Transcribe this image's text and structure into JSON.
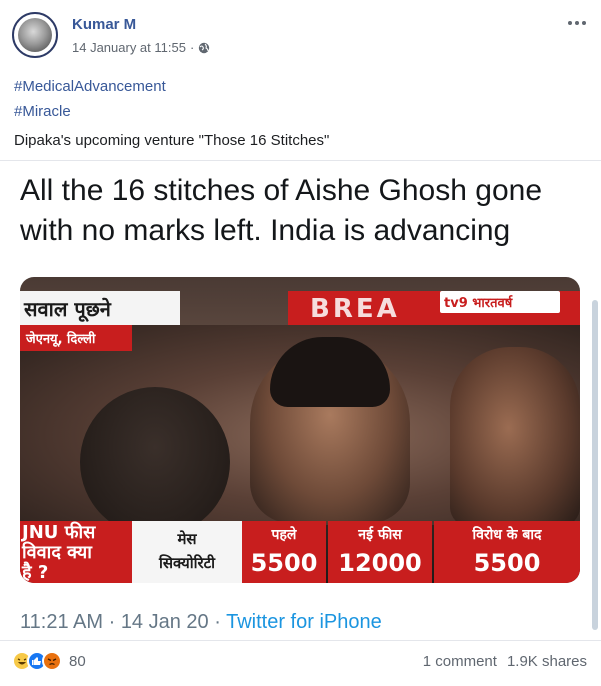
{
  "post": {
    "author": "Kumar M",
    "timestamp": "14 January at 11:55",
    "privacy_icon": "globe-icon",
    "hashtags": [
      "#MedicalAdvancement",
      "#Miracle"
    ],
    "caption": "Dipaka's upcoming venture \"Those 16 Stitches\""
  },
  "tweet": {
    "text": "All the 16 stitches of Aishe Ghosh gone with no marks left. India is advancing",
    "media": {
      "top_left": "सवाल पूछने",
      "sub": "जेएनयू, दिल्ली",
      "breaking": "BREA",
      "logo": "tv9 भारतवर्ष",
      "bottom": {
        "left_label_line1": "JNU फीस",
        "left_label_line2": "विवाद क्या",
        "left_label_line3": "है ?",
        "mess_line1": "मेस",
        "mess_line2": "सिक्योरिटी",
        "col1_label": "पहले",
        "col1_value": "5500",
        "col2_label": "नई फीस",
        "col2_value": "12000",
        "col3_label": "विरोध के बाद",
        "col3_value": "5500"
      }
    },
    "time": "11:21 AM",
    "date": "14 Jan 20",
    "source": "Twitter for iPhone"
  },
  "footer": {
    "reaction_icons": [
      "haha-icon",
      "like-icon",
      "angry-icon"
    ],
    "reaction_count": "80",
    "comments": "1 comment",
    "shares": "1.9K shares"
  },
  "colors": {
    "link": "#385898",
    "twitter_blue": "#1b95e0",
    "tv_red": "#c81e1e"
  }
}
